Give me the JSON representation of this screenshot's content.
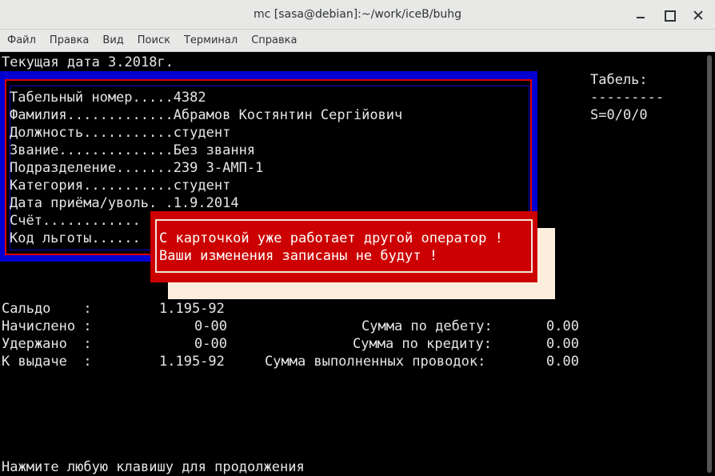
{
  "window": {
    "title": "mc [sasa@debian]:~/work/iceB/buhg"
  },
  "menu": [
    "Файл",
    "Правка",
    "Вид",
    "Поиск",
    "Терминал",
    "Справка"
  ],
  "terminal": {
    "current_date": "Текущая дата 3.2018г.",
    "tabel": {
      "label": "Табель:",
      "divider": "---------",
      "value": "S=0/0/0"
    },
    "card": {
      "fields": [
        "Табельный номер.....4382",
        "Фамилия.............Абрамов Костянтин Сергійович",
        "Должность...........студент",
        "Звание..............Без звання",
        "Подразделение.......239 3-АМП-1",
        "Категория...........студент",
        "Дата приёма/уволь. .1.9.2014",
        "Счёт............",
        "Код льготы......"
      ]
    },
    "alert": {
      "line1": "С карточкой уже работает другой оператор !",
      "line2": "Ваши изменения записаны не будут !"
    },
    "totals": {
      "rows": [
        {
          "label": "Сальдо    :",
          "value": "1.195-92"
        },
        {
          "label": "Начислено :",
          "value": "0-00"
        },
        {
          "label": "Удержано  :",
          "value": "0-00"
        },
        {
          "label": "К выдаче  :",
          "value": "1.195-92"
        }
      ],
      "sums": [
        {
          "label": "Сумма по дебету:",
          "value": "0.00"
        },
        {
          "label": "Сумма по кредиту:",
          "value": "0.00"
        },
        {
          "label": "Сумма выполненных проводок:",
          "value": "0.00"
        }
      ]
    },
    "prompt": "Нажмите любую клавишу для продолжения"
  }
}
